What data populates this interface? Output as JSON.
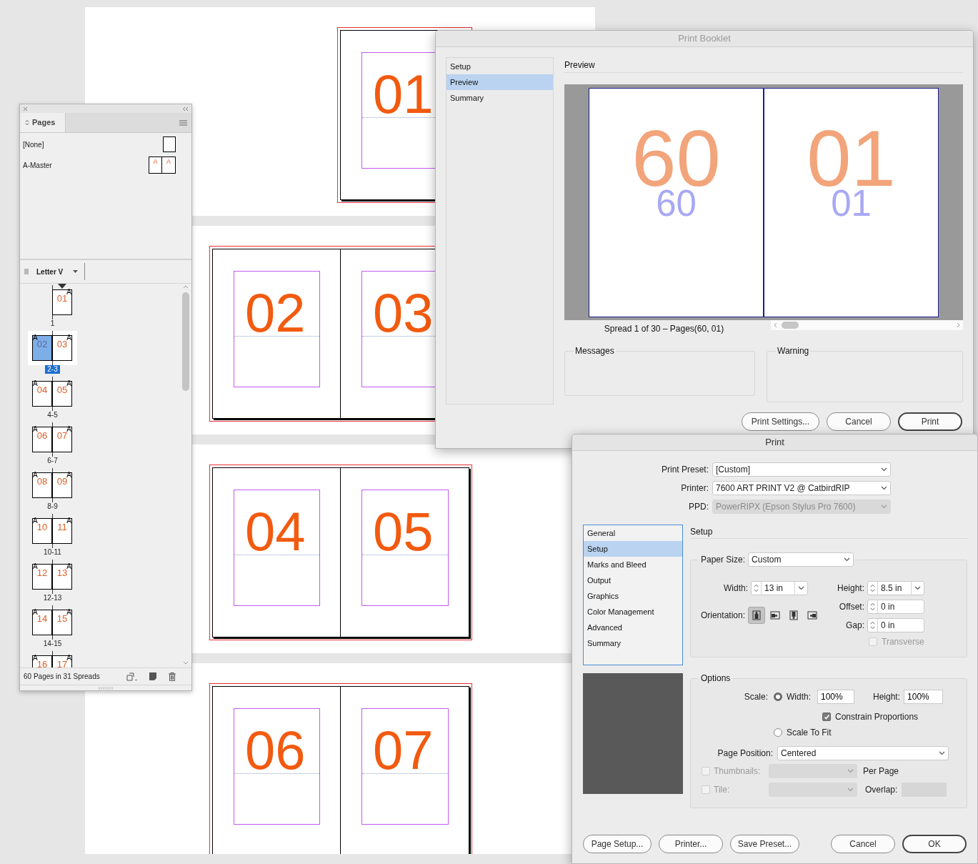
{
  "document": {
    "spreads": [
      {
        "pages": [
          {
            "number": "01"
          }
        ]
      },
      {
        "pages": [
          {
            "number": "02"
          },
          {
            "number": "03"
          }
        ]
      },
      {
        "pages": [
          {
            "number": "04"
          },
          {
            "number": "05"
          }
        ]
      },
      {
        "pages": [
          {
            "number": "06"
          },
          {
            "number": "07"
          }
        ]
      }
    ]
  },
  "pages_panel": {
    "tab": "Pages",
    "masters": [
      {
        "name": "[None]",
        "kind": "blank"
      },
      {
        "name": "A-Master",
        "kind": "master",
        "marks": [
          "A",
          "A"
        ]
      }
    ],
    "page_size": "Letter V",
    "spreads": [
      {
        "label": "1",
        "selected": false,
        "section_start": true,
        "pages": [
          {
            "number": "01",
            "master": "A",
            "selected": false
          }
        ]
      },
      {
        "label": "2-3",
        "selected": true,
        "section_start": false,
        "pages": [
          {
            "number": "02",
            "master": "A",
            "selected": true
          },
          {
            "number": "03",
            "master": "A",
            "selected": false
          }
        ]
      },
      {
        "label": "4-5",
        "selected": false,
        "section_start": false,
        "pages": [
          {
            "number": "04",
            "master": "A",
            "selected": false
          },
          {
            "number": "05",
            "master": "A",
            "selected": false
          }
        ]
      },
      {
        "label": "6-7",
        "selected": false,
        "section_start": false,
        "pages": [
          {
            "number": "06",
            "master": "A",
            "selected": false
          },
          {
            "number": "07",
            "master": "A",
            "selected": false
          }
        ]
      },
      {
        "label": "8-9",
        "selected": false,
        "section_start": false,
        "pages": [
          {
            "number": "08",
            "master": "A",
            "selected": false
          },
          {
            "number": "09",
            "master": "A",
            "selected": false
          }
        ]
      },
      {
        "label": "10-11",
        "selected": false,
        "section_start": false,
        "pages": [
          {
            "number": "10",
            "master": "A",
            "selected": false
          },
          {
            "number": "11",
            "master": "A",
            "selected": false
          }
        ]
      },
      {
        "label": "12-13",
        "selected": false,
        "section_start": false,
        "pages": [
          {
            "number": "12",
            "master": "A",
            "selected": false
          },
          {
            "number": "13",
            "master": "A",
            "selected": false
          }
        ]
      },
      {
        "label": "14-15",
        "selected": false,
        "section_start": false,
        "pages": [
          {
            "number": "14",
            "master": "A",
            "selected": false
          },
          {
            "number": "15",
            "master": "A",
            "selected": false
          }
        ]
      },
      {
        "selected": false,
        "section_start": false,
        "pages": [
          {
            "number": "16",
            "master": "A",
            "selected": false
          },
          {
            "number": "17",
            "master": "A",
            "selected": false
          }
        ]
      }
    ],
    "status": "60 Pages in 31 Spreads"
  },
  "print_booklet": {
    "title": "Print Booklet",
    "nav": [
      {
        "label": "Setup",
        "selected": false
      },
      {
        "label": "Preview",
        "selected": true
      },
      {
        "label": "Summary",
        "selected": false
      }
    ],
    "section": "Preview",
    "preview": {
      "pages": [
        {
          "large": "60",
          "small": "60"
        },
        {
          "large": "01",
          "small": "01"
        }
      ]
    },
    "caption": "Spread 1 of 30 – Pages(60, 01)",
    "groups": [
      {
        "title": "Messages"
      },
      {
        "title": "Warning"
      }
    ],
    "buttons": [
      {
        "label": "Print Settings...",
        "default": false
      },
      {
        "label": "Cancel",
        "default": false
      },
      {
        "label": "Print",
        "default": true
      }
    ]
  },
  "print": {
    "title": "Print",
    "fields": [
      {
        "label": "Print Preset:",
        "value": "[Custom]",
        "disabled": false
      },
      {
        "label": "Printer:",
        "value": "7600 ART PRINT V2 @ CatbirdRIP",
        "disabled": false
      },
      {
        "label": "PPD:",
        "value": "PowerRIPX (Epson Stylus Pro 7600)",
        "disabled": true
      }
    ],
    "nav": [
      {
        "label": "General",
        "selected": false
      },
      {
        "label": "Setup",
        "selected": true
      },
      {
        "label": "Marks and Bleed",
        "selected": false
      },
      {
        "label": "Output",
        "selected": false
      },
      {
        "label": "Graphics",
        "selected": false
      },
      {
        "label": "Color Management",
        "selected": false
      },
      {
        "label": "Advanced",
        "selected": false
      },
      {
        "label": "Summary",
        "selected": false
      }
    ],
    "section": "Setup",
    "paper": {
      "label": "Paper Size:",
      "value": "Custom",
      "width": {
        "label": "Width:",
        "value": "13 in"
      },
      "height": {
        "label": "Height:",
        "value": "8.5 in"
      },
      "offset": {
        "label": "Offset:",
        "value": "0 in"
      },
      "gap": {
        "label": "Gap:",
        "value": "0 in"
      },
      "orientation": {
        "label": "Orientation:",
        "options": [
          {
            "selected": true
          },
          {
            "selected": false
          },
          {
            "selected": false
          },
          {
            "selected": false
          }
        ]
      },
      "transverse": {
        "label": "Transverse",
        "checked": false,
        "disabled": true
      }
    },
    "options": {
      "title": "Options",
      "scale_label": "Scale:",
      "scale_width": {
        "label": "Width:",
        "selected": true,
        "value": "100%"
      },
      "scale_height": {
        "label": "Height:",
        "value": "100%"
      },
      "constrain": {
        "label": "Constrain Proportions",
        "checked": true
      },
      "scale_to_fit": {
        "label": "Scale To Fit",
        "selected": false
      },
      "page_position": {
        "label": "Page Position:",
        "value": "Centered"
      },
      "thumbnails": {
        "label": "Thumbnails:",
        "checked": false,
        "disabled": true,
        "suffix": "Per Page"
      },
      "tile": {
        "label": "Tile:",
        "checked": false,
        "disabled": true,
        "overlap_label": "Overlap:"
      }
    },
    "buttons_left": [
      {
        "label": "Page Setup...",
        "default": false
      },
      {
        "label": "Printer...",
        "default": false
      },
      {
        "label": "Save Preset...",
        "default": false
      }
    ],
    "buttons_right": [
      {
        "label": "Cancel",
        "default": false
      },
      {
        "label": "OK",
        "default": true
      }
    ]
  }
}
